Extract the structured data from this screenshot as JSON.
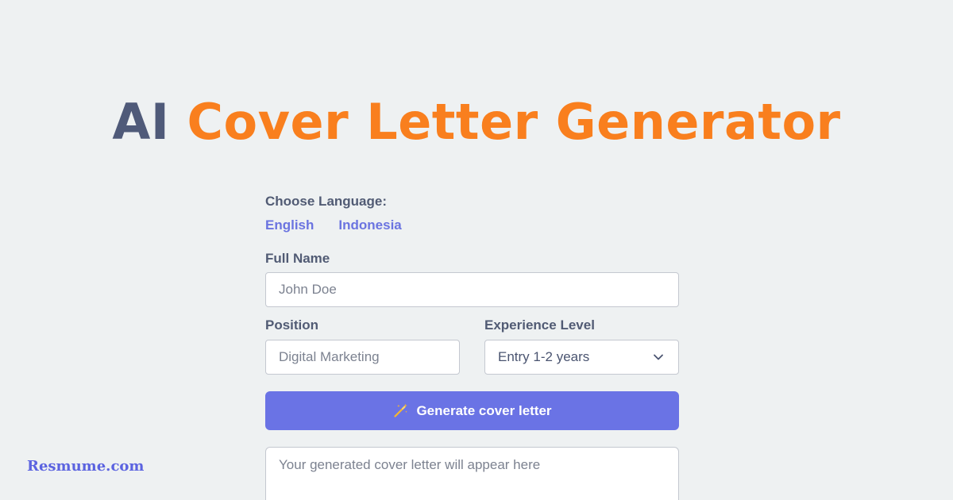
{
  "title": {
    "part1": "AI",
    "part2": "Cover Letter Generator"
  },
  "colors": {
    "title_dark": "#4f5a79",
    "title_accent": "#f97f1e",
    "button_bg": "#6a73e5",
    "link": "#6b74e0",
    "background": "#eef1f2"
  },
  "language": {
    "label": "Choose Language:",
    "options": [
      "English",
      "Indonesia"
    ]
  },
  "full_name": {
    "label": "Full Name",
    "placeholder": "John Doe"
  },
  "position": {
    "label": "Position",
    "placeholder": "Digital Marketing"
  },
  "experience": {
    "label": "Experience Level",
    "selected": "Entry 1-2 years",
    "icon": "chevron-down-icon"
  },
  "generate_button": {
    "label": "Generate cover letter",
    "icon": "magic-wand-icon"
  },
  "output": {
    "placeholder": "Your generated cover letter will appear here"
  },
  "brand": "Resmume.com"
}
